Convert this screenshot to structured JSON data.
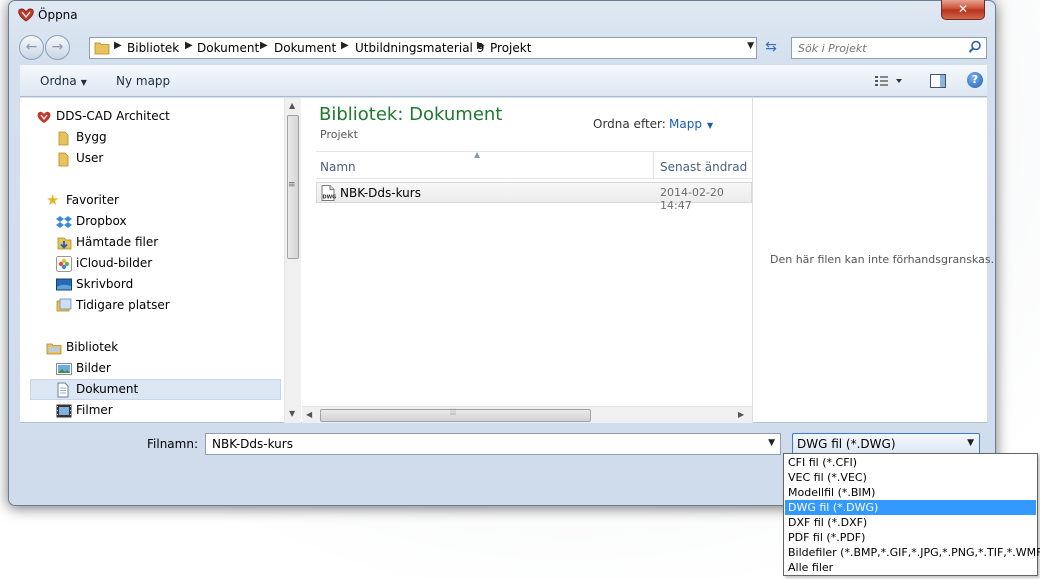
{
  "window": {
    "title": "Öppna",
    "close_label": "✕"
  },
  "address": {
    "crumbs": [
      "Bibliotek",
      "Dokument",
      "Dokument",
      "Utbildningsmaterial 9",
      "Projekt"
    ]
  },
  "search": {
    "placeholder": "Sök i Projekt"
  },
  "toolbar": {
    "organize_label": "Ordna",
    "new_folder_label": "Ny mapp"
  },
  "sidebar": {
    "items": [
      {
        "label": "DDS-CAD Architect",
        "icon": "dds-app-icon"
      },
      {
        "label": "Bygg",
        "icon": "folder-icon"
      },
      {
        "label": "User",
        "icon": "folder-icon"
      },
      {
        "label": "Favoriter",
        "icon": "star-icon"
      },
      {
        "label": "Dropbox",
        "icon": "dropbox-icon"
      },
      {
        "label": "Hämtade filer",
        "icon": "downloads-folder-icon"
      },
      {
        "label": "iCloud-bilder",
        "icon": "icloud-photos-icon"
      },
      {
        "label": "Skrivbord",
        "icon": "desktop-icon"
      },
      {
        "label": "Tidigare platser",
        "icon": "recent-places-icon"
      },
      {
        "label": "Bibliotek",
        "icon": "library-icon"
      },
      {
        "label": "Bilder",
        "icon": "pictures-icon"
      },
      {
        "label": "Dokument",
        "icon": "documents-icon"
      },
      {
        "label": "Filmer",
        "icon": "videos-icon"
      }
    ]
  },
  "main": {
    "library_title": "Bibliotek: Dokument",
    "library_subtitle": "Projekt",
    "arrange_label": "Ordna efter:",
    "arrange_value": "Mapp",
    "columns": {
      "name": "Namn",
      "date": "Senast ändrad"
    },
    "files": [
      {
        "name": "NBK-Dds-kurs",
        "date": "2014-02-20 14:47",
        "icon": "dwg-file-icon"
      }
    ]
  },
  "preview": {
    "message": "Den här filen kan inte förhandsgranskas."
  },
  "footer": {
    "filename_label": "Filnamn:",
    "filename_value": "NBK-Dds-kurs",
    "filetype_value": "DWG fil (*.DWG)"
  },
  "filetype_options": [
    "CFI fil (*.CFI)",
    "VEC fil (*.VEC)",
    "Modellfil (*.BIM)",
    "DWG fil (*.DWG)",
    "DXF fil (*.DXF)",
    "PDF fil (*.PDF)",
    "Bildefiler (*.BMP,*.GIF,*.JPG,*.PNG,*.TIF,*.WMF)",
    "Alle filer"
  ],
  "colors": {
    "accent": "#3399ff",
    "library_title": "#1e7a2e",
    "link": "#1a5bb5"
  }
}
